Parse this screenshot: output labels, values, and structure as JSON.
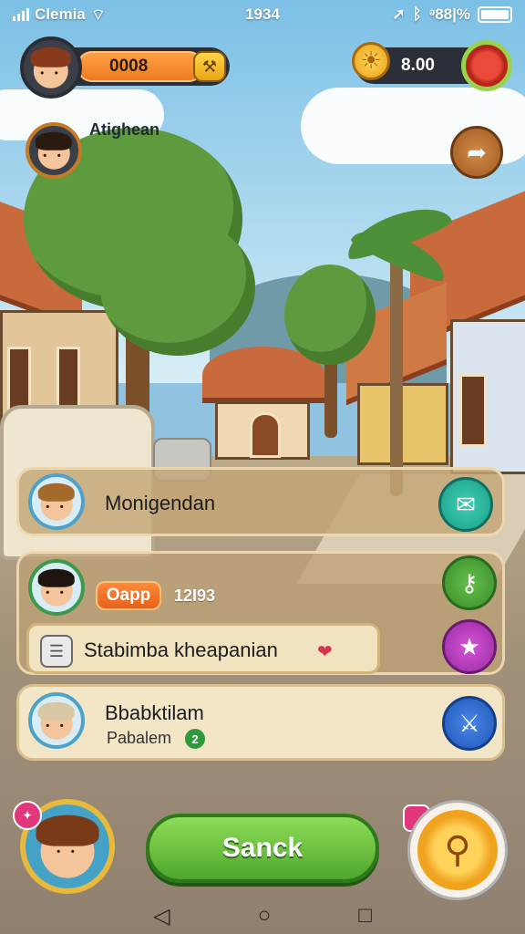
{
  "status_bar": {
    "carrier": "Clemia",
    "time": "1934",
    "battery_text": "ᵊ88|%"
  },
  "hud": {
    "score": "0008",
    "coin_icon": "hammer-icon",
    "balance": "8.00"
  },
  "companion": {
    "name": "Atighean"
  },
  "list": {
    "item1": {
      "title": "Monigendan"
    },
    "item2": {
      "tag": "Oapp",
      "number": "12I93",
      "bar_text": "Stabimba kheapanian"
    },
    "item3": {
      "title": "Bbabktilam",
      "subtitle": "Pabalem",
      "badge": "2"
    }
  },
  "cta": {
    "label": "Sanck"
  },
  "colors": {
    "cta_green": "#5fba36",
    "hud_orange": "#f28a2e",
    "panel_tan": "#c4a676"
  }
}
